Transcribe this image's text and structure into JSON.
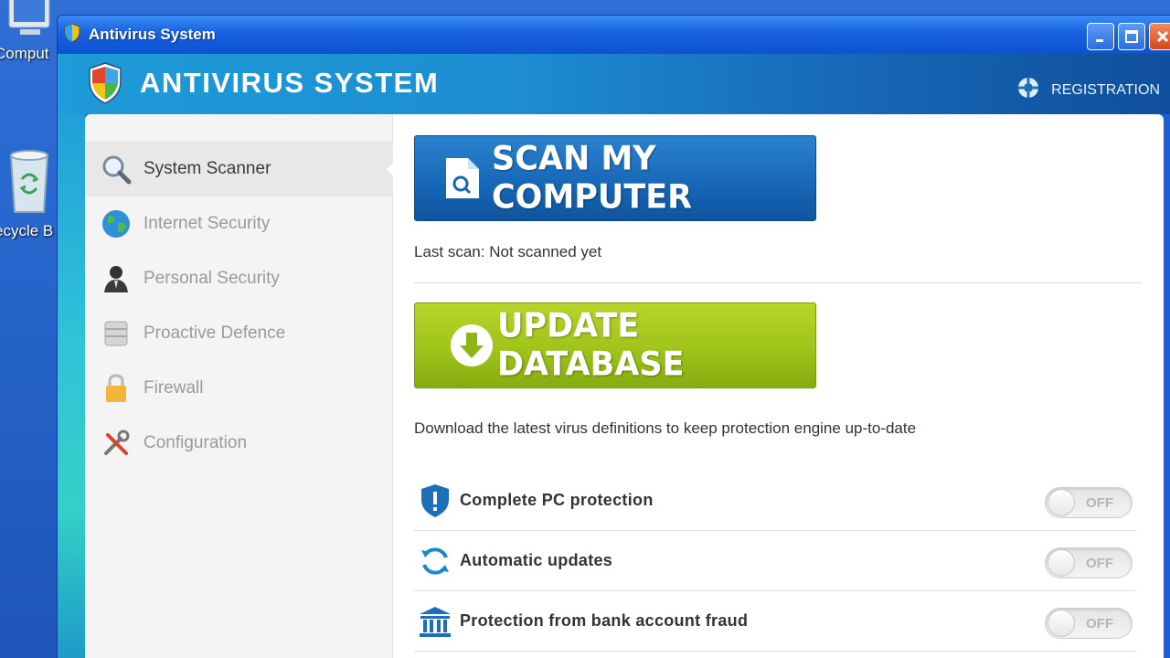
{
  "desktop": {
    "icons": [
      {
        "label": "Comput",
        "icon": "computer-icon"
      },
      {
        "label": "ecycle B",
        "icon": "recycle-bin-icon"
      }
    ]
  },
  "window": {
    "title": "Antivirus System",
    "controls": [
      "minimize",
      "maximize",
      "close"
    ]
  },
  "header": {
    "app_title": "ANTIVIRUS SYSTEM",
    "registration": "REGISTRATION"
  },
  "sidebar": {
    "items": [
      {
        "label": "System Scanner",
        "icon": "magnifier-icon",
        "active": true
      },
      {
        "label": "Internet Security",
        "icon": "globe-icon",
        "active": false
      },
      {
        "label": "Personal Security",
        "icon": "person-icon",
        "active": false
      },
      {
        "label": "Proactive Defence",
        "icon": "database-icon",
        "active": false
      },
      {
        "label": "Firewall",
        "icon": "lock-icon",
        "active": false
      },
      {
        "label": "Configuration",
        "icon": "tools-icon",
        "active": false
      }
    ]
  },
  "main": {
    "scan_button": "SCAN MY COMPUTER",
    "last_scan": "Last scan: Not scanned yet",
    "update_button": "UPDATE DATABASE",
    "update_desc": "Download the latest virus definitions to keep protection engine up-to-date",
    "protections": [
      {
        "label": "Complete PC protection",
        "icon": "shield-alert-icon",
        "toggle": "OFF"
      },
      {
        "label": "Automatic updates",
        "icon": "refresh-icon",
        "toggle": "OFF"
      },
      {
        "label": "Protection from bank account fraud",
        "icon": "bank-icon",
        "toggle": "OFF"
      }
    ]
  },
  "colors": {
    "scan_blue": "#1666b6",
    "update_green": "#9fc41a",
    "titlebar_blue": "#1761e1"
  }
}
